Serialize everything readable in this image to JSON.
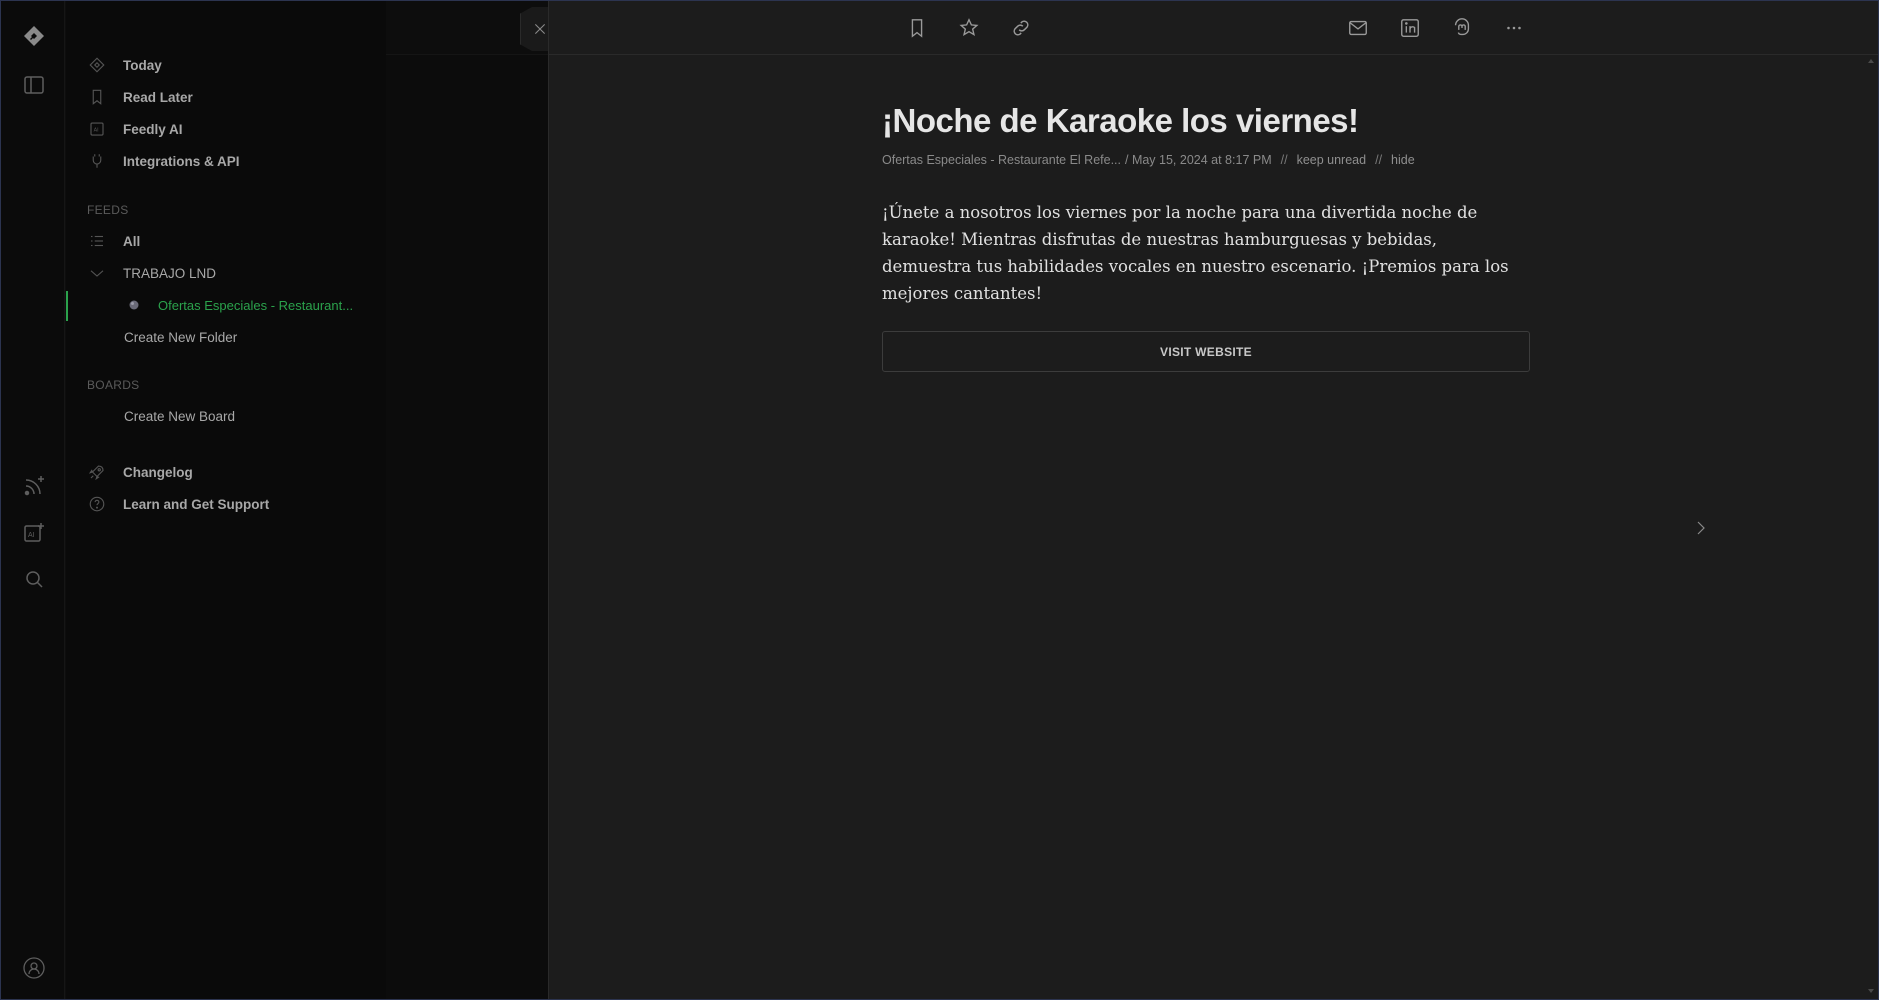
{
  "nav": {
    "primary": [
      {
        "label": "Today",
        "icon": "today-icon"
      },
      {
        "label": "Read Later",
        "icon": "bookmark-icon"
      },
      {
        "label": "Feedly AI",
        "icon": "ai-icon"
      },
      {
        "label": "Integrations & API",
        "icon": "plug-icon"
      }
    ],
    "feeds_header": "FEEDS",
    "feeds_all": "All",
    "folder_name": "TRABAJO LND",
    "feed_source": "Ofertas Especiales - Restaurant...",
    "create_folder": "Create New Folder",
    "boards_header": "BOARDS",
    "create_board": "Create New Board",
    "changelog": "Changelog",
    "support": "Learn and Get Support"
  },
  "article": {
    "title": "¡Noche de Karaoke los viernes!",
    "source": "Ofertas Especiales - Restaurante El Refe...",
    "date": "/ May 15, 2024 at 8:17 PM",
    "separator": "//",
    "keep_unread": "keep unread",
    "hide": "hide",
    "body": "¡Únete a nosotros los viernes por la noche para una divertida noche de karaoke! Mientras disfrutas de nuestras hamburguesas y bebidas, demuestra tus habilidades vocales en nuestro escenario. ¡Premios para los mejores cantantes!",
    "visit_label": "VISIT WEBSITE"
  },
  "colors": {
    "accent": "#2ba24c",
    "article_bg": "#1c1c1c",
    "nav_bg": "#0a0a0a"
  }
}
